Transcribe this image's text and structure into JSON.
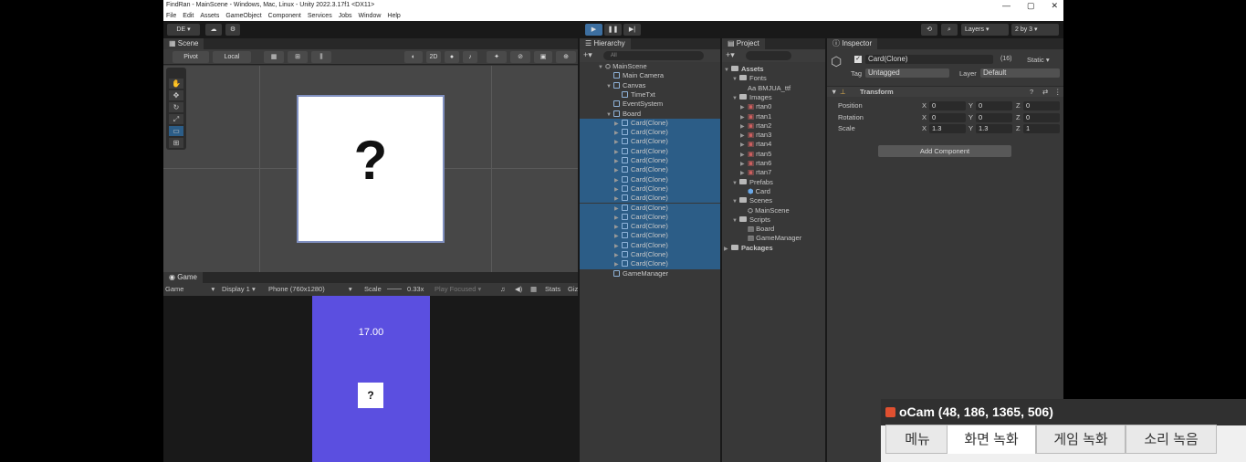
{
  "titlebar": {
    "text": "FindRan - MainScene - Windows, Mac, Linux - Unity 2022.3.17f1 <DX11>",
    "min": "—",
    "max": "▢",
    "close": "✕"
  },
  "menu": [
    "File",
    "Edit",
    "Assets",
    "GameObject",
    "Component",
    "Services",
    "Jobs",
    "Window",
    "Help"
  ],
  "toolbar": {
    "account": "DE ▾",
    "layers": "Layers",
    "layout": "2 by 3"
  },
  "scene": {
    "tab": "Scene",
    "pivot": "Pivot",
    "local": "Local",
    "mode2d": "2D",
    "card_symbol": "?"
  },
  "game": {
    "tab": "Game",
    "view": "Game",
    "display": "Display 1",
    "resolution": "Phone (760x1280)",
    "scale_label": "Scale",
    "scale_value": "0.33x",
    "play_focused": "Play Focused",
    "stats": "Stats",
    "gizmos": "Giz",
    "timer": "17.00",
    "card_symbol": "?"
  },
  "hierarchy": {
    "tab": "Hierarchy",
    "search_placeholder": "All",
    "items": [
      {
        "label": "MainScene",
        "indent": 0,
        "icon": "scene",
        "arrow": "▼"
      },
      {
        "label": "Main Camera",
        "indent": 1,
        "icon": "cube",
        "arrow": ""
      },
      {
        "label": "Canvas",
        "indent": 1,
        "icon": "cube",
        "arrow": "▼"
      },
      {
        "label": "TimeTxt",
        "indent": 2,
        "icon": "cube",
        "arrow": ""
      },
      {
        "label": "EventSystem",
        "indent": 1,
        "icon": "cube",
        "arrow": ""
      },
      {
        "label": "Board",
        "indent": 1,
        "icon": "cube",
        "arrow": "▼"
      },
      {
        "label": "Card(Clone)",
        "indent": 2,
        "icon": "cube",
        "arrow": "▶",
        "sel": true
      },
      {
        "label": "Card(Clone)",
        "indent": 2,
        "icon": "cube",
        "arrow": "▶",
        "sel": true
      },
      {
        "label": "Card(Clone)",
        "indent": 2,
        "icon": "cube",
        "arrow": "▶",
        "sel": true
      },
      {
        "label": "Card(Clone)",
        "indent": 2,
        "icon": "cube",
        "arrow": "▶",
        "sel": true
      },
      {
        "label": "Card(Clone)",
        "indent": 2,
        "icon": "cube",
        "arrow": "▶",
        "sel": true
      },
      {
        "label": "Card(Clone)",
        "indent": 2,
        "icon": "cube",
        "arrow": "▶",
        "sel": true
      },
      {
        "label": "Card(Clone)",
        "indent": 2,
        "icon": "cube",
        "arrow": "▶",
        "sel": true
      },
      {
        "label": "Card(Clone)",
        "indent": 2,
        "icon": "cube",
        "arrow": "▶",
        "sel": true
      },
      {
        "label": "Card(Clone)",
        "indent": 2,
        "icon": "cube",
        "arrow": "▶",
        "sel": true
      },
      {
        "label": "Card(Clone)",
        "indent": 2,
        "icon": "cube",
        "arrow": "▶",
        "sel": true
      },
      {
        "label": "Card(Clone)",
        "indent": 2,
        "icon": "cube",
        "arrow": "▶",
        "sel": true
      },
      {
        "label": "Card(Clone)",
        "indent": 2,
        "icon": "cube",
        "arrow": "▶",
        "sel": true
      },
      {
        "label": "Card(Clone)",
        "indent": 2,
        "icon": "cube",
        "arrow": "▶",
        "sel": true
      },
      {
        "label": "Card(Clone)",
        "indent": 2,
        "icon": "cube",
        "arrow": "▶",
        "sel": true
      },
      {
        "label": "Card(Clone)",
        "indent": 2,
        "icon": "cube",
        "arrow": "▶",
        "sel": true
      },
      {
        "label": "Card(Clone)",
        "indent": 2,
        "icon": "cube",
        "arrow": "▶",
        "sel": true
      },
      {
        "label": "GameManager",
        "indent": 1,
        "icon": "cube",
        "arrow": ""
      }
    ]
  },
  "project": {
    "tab": "Project",
    "items": [
      {
        "label": "Assets",
        "indent": 0,
        "icon": "folder",
        "arrow": "▼",
        "bold": true
      },
      {
        "label": "Fonts",
        "indent": 1,
        "icon": "folder",
        "arrow": "▼"
      },
      {
        "label": "BMJUA_ttf",
        "indent": 2,
        "icon": "font",
        "arrow": ""
      },
      {
        "label": "Images",
        "indent": 1,
        "icon": "folder",
        "arrow": "▼"
      },
      {
        "label": "rtan0",
        "indent": 2,
        "icon": "img",
        "arrow": "▶"
      },
      {
        "label": "rtan1",
        "indent": 2,
        "icon": "img",
        "arrow": "▶"
      },
      {
        "label": "rtan2",
        "indent": 2,
        "icon": "img",
        "arrow": "▶"
      },
      {
        "label": "rtan3",
        "indent": 2,
        "icon": "img",
        "arrow": "▶"
      },
      {
        "label": "rtan4",
        "indent": 2,
        "icon": "img",
        "arrow": "▶"
      },
      {
        "label": "rtan5",
        "indent": 2,
        "icon": "img",
        "arrow": "▶"
      },
      {
        "label": "rtan6",
        "indent": 2,
        "icon": "img",
        "arrow": "▶"
      },
      {
        "label": "rtan7",
        "indent": 2,
        "icon": "img",
        "arrow": "▶"
      },
      {
        "label": "Prefabs",
        "indent": 1,
        "icon": "folder",
        "arrow": "▼"
      },
      {
        "label": "Card",
        "indent": 2,
        "icon": "prefab",
        "arrow": ""
      },
      {
        "label": "Scenes",
        "indent": 1,
        "icon": "folder",
        "arrow": "▼"
      },
      {
        "label": "MainScene",
        "indent": 2,
        "icon": "scene",
        "arrow": ""
      },
      {
        "label": "Scripts",
        "indent": 1,
        "icon": "folder",
        "arrow": "▼"
      },
      {
        "label": "Board",
        "indent": 2,
        "icon": "script",
        "arrow": ""
      },
      {
        "label": "GameManager",
        "indent": 2,
        "icon": "script",
        "arrow": ""
      },
      {
        "label": "Packages",
        "indent": 0,
        "icon": "folder",
        "arrow": "▶",
        "bold": true
      }
    ]
  },
  "inspector": {
    "tab": "Inspector",
    "name": "Card(Clone)",
    "count": "(16)",
    "static": "Static",
    "tag_label": "Tag",
    "tag": "Untagged",
    "layer_label": "Layer",
    "layer": "Default",
    "component": "Transform",
    "rows": [
      {
        "label": "Position",
        "x": "0",
        "y": "0",
        "z": "0"
      },
      {
        "label": "Rotation",
        "x": "0",
        "y": "0",
        "z": "0"
      },
      {
        "label": "Scale",
        "x": "1.3",
        "y": "1.3",
        "z": "1"
      }
    ],
    "add_component": "Add Component"
  },
  "ocam": {
    "title": "oCam (48, 186, 1365, 506)",
    "tabs": [
      "메뉴",
      "화면 녹화",
      "게임 녹화",
      "소리 녹음"
    ]
  },
  "colors": {
    "selection": "#2c5d87",
    "game_bg": "#5b4fe0",
    "scene_bg": "#474747"
  }
}
